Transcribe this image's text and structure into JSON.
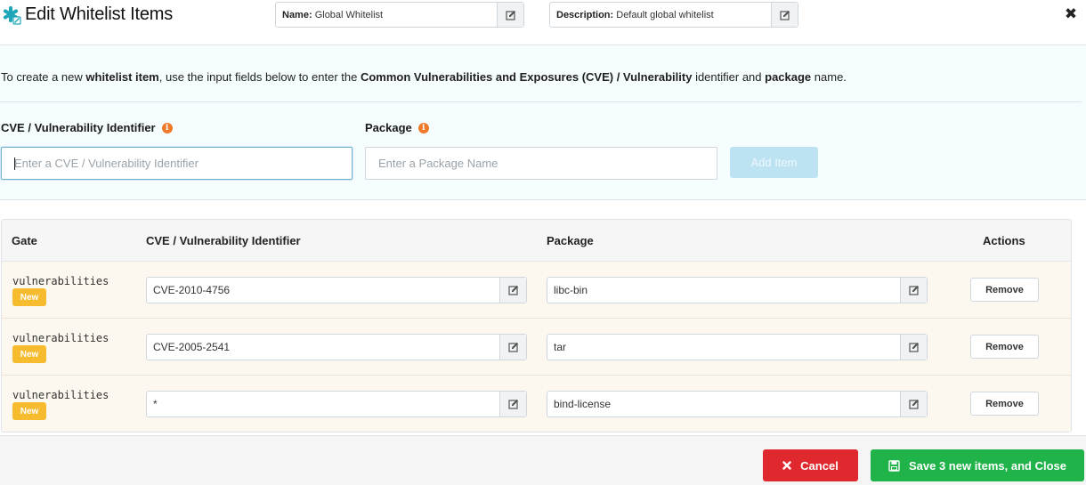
{
  "header": {
    "title": "Edit Whitelist Items",
    "name_label": "Name:",
    "name_value": "Global Whitelist",
    "description_label": "Description:",
    "description_value": "Default global whitelist"
  },
  "intro": {
    "p1": "To create a new ",
    "b1": "whitelist item",
    "p2": ", use the input fields below to enter the ",
    "b2": "Common Vulnerabilities and Exposures (CVE) / Vulnerability",
    "p3": " identifier and ",
    "b3": "package",
    "p4": " name."
  },
  "form": {
    "cve_label": "CVE / Vulnerability Identifier",
    "cve_placeholder": "Enter a CVE / Vulnerability Identifier",
    "package_label": "Package",
    "package_placeholder": "Enter a Package Name",
    "add_button": "Add Item"
  },
  "table": {
    "headers": {
      "gate": "Gate",
      "cve": "CVE / Vulnerability Identifier",
      "package": "Package",
      "actions": "Actions"
    },
    "rows": [
      {
        "gate": "vulnerabilities",
        "badge": "New",
        "cve": "CVE-2010-4756",
        "package": "libc-bin",
        "action": "Remove"
      },
      {
        "gate": "vulnerabilities",
        "badge": "New",
        "cve": "CVE-2005-2541",
        "package": "tar",
        "action": "Remove"
      },
      {
        "gate": "vulnerabilities",
        "badge": "New",
        "cve": "*",
        "package": "bind-license",
        "action": "Remove"
      }
    ]
  },
  "footer": {
    "cancel_label": "Cancel",
    "save_label": "Save 3 new items, and Close"
  },
  "colors": {
    "accent_teal": "#1fa5b8",
    "info_orange": "#ef7a2b",
    "badge_new": "#f6bb2e",
    "cancel_red": "#e0292e",
    "save_green": "#20b34a",
    "add_disabled": "#bde3f3"
  },
  "icons": {
    "logo": "anchore-asterisk-edit-icon",
    "field_edit": "pencil-square-icon",
    "close": "close-icon",
    "info": "info-circle-icon",
    "cancel": "times-icon",
    "save": "floppy-disk-icon"
  }
}
